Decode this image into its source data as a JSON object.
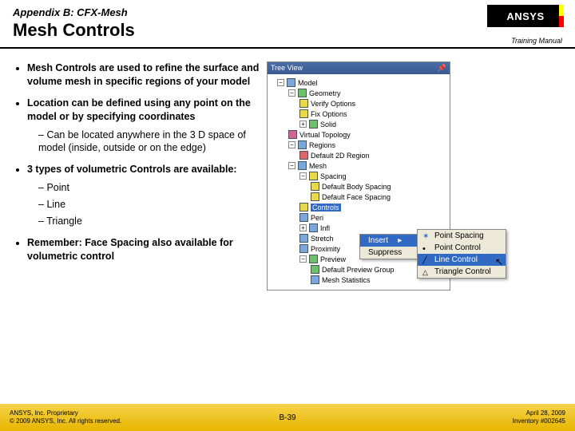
{
  "header": {
    "appendix": "Appendix B: CFX-Mesh",
    "title": "Mesh Controls",
    "logo_text": "ANSYS",
    "training_manual": "Training Manual"
  },
  "bullets": {
    "b1": "Mesh Controls are used to refine the surface and volume mesh in specific regions of your model",
    "b2": "Location can be defined using any point on the model or by specifying coordinates",
    "b2a": "Can be located anywhere in the 3 D space of model (inside, outside or on the edge)",
    "b3": "3 types of volumetric Controls are available:",
    "b3a": "Point",
    "b3b": "Line",
    "b3c": "Triangle",
    "b4": "Remember: Face Spacing also available for volumetric control"
  },
  "tree": {
    "header": "Tree View",
    "pin": "📌",
    "model": "Model",
    "geometry": "Geometry",
    "verify": "Verify Options",
    "fix": "Fix Options",
    "solid": "Solid",
    "vtopo": "Virtual Topology",
    "regions": "Regions",
    "d2d": "Default 2D Region",
    "mesh": "Mesh",
    "spacing": "Spacing",
    "dbody": "Default Body Spacing",
    "dface": "Default Face Spacing",
    "controls": "Controls",
    "peri": "Peri",
    "infl": "Infl",
    "stretch": "Stretch",
    "prox": "Proximity",
    "preview": "Preview",
    "dprev": "Default Preview Group",
    "stats": "Mesh Statistics"
  },
  "ctx": {
    "insert": "Insert",
    "suppress": "Suppress"
  },
  "sub": {
    "ps": "Point Spacing",
    "pc": "Point Control",
    "lc": "Line Control",
    "tc": "Triangle Control"
  },
  "footer": {
    "prop1": "ANSYS, Inc. Proprietary",
    "prop2": "© 2009 ANSYS, Inc. All rights reserved.",
    "page": "B-39",
    "date": "April 28, 2009",
    "inv": "Inventory #002645"
  }
}
